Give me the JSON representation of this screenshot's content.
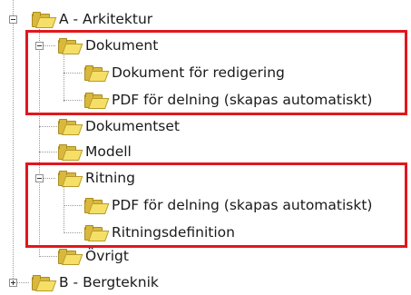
{
  "tree": {
    "arkitektur": "A - Arkitektur",
    "dokument": "Dokument",
    "dokument_for_redigering": "Dokument för redigering",
    "pdf_for_delning_1": "PDF för delning (skapas automatiskt)",
    "dokumentset": "Dokumentset",
    "modell": "Modell",
    "ritning": "Ritning",
    "pdf_for_delning_2": "PDF för delning (skapas automatiskt)",
    "ritningsdefinition": "Ritningsdefinition",
    "ovrigt": "Övrigt",
    "bergteknik": "B - Bergteknik"
  },
  "highlight_color": "#e0171d",
  "folder_icon": "folder-open-icon"
}
